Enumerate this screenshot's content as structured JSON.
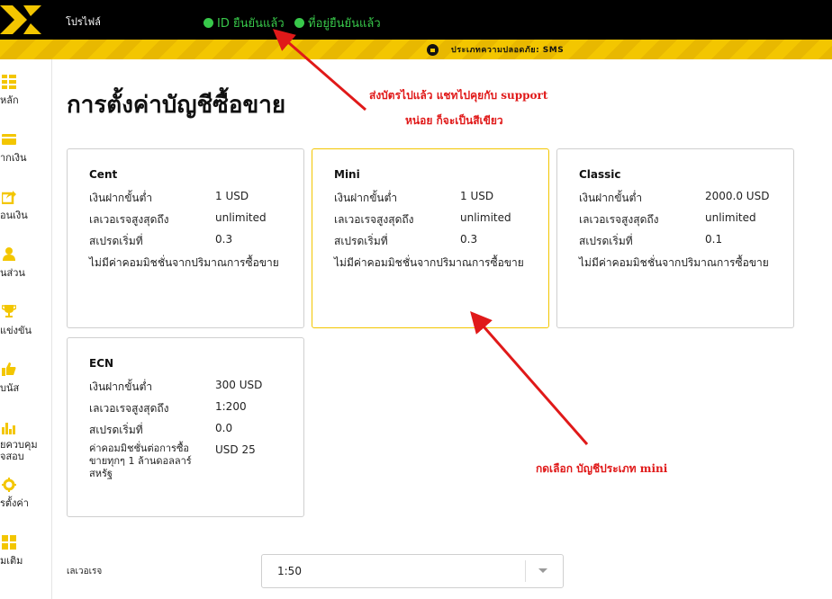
{
  "topbar": {
    "profile_label": "โปรไฟล์",
    "id_verified": "ID ยืนยันแล้ว",
    "address_verified": "ที่อยู่ยืนยันแล้ว",
    "security_type": "ประเภทความปลอดภัย: SMS"
  },
  "sidebar": {
    "items": [
      {
        "label": "หลัก",
        "icon": "dashboard-icon"
      },
      {
        "label": "ากเงิน",
        "icon": "card-icon"
      },
      {
        "label": "อนเงิน",
        "icon": "share-icon"
      },
      {
        "label": "นส่วน",
        "icon": "user-icon"
      },
      {
        "label": "แข่งขัน",
        "icon": "trophy-icon"
      },
      {
        "label": "บนัส",
        "icon": "thumbs-up-icon"
      },
      {
        "label": "ยควบคุม\nจสอบ",
        "icon": "bar-chart-icon"
      },
      {
        "label": "รตั้งค่า",
        "icon": "gear-icon"
      },
      {
        "label": "มเติม",
        "icon": "grid-icon"
      }
    ]
  },
  "page": {
    "title": "การตั้งค่าบัญชีซื้อขาย"
  },
  "accounts": [
    {
      "name": "Cent",
      "min_deposit_label": "เงินฝากขั้นต่ำ",
      "min_deposit": "1 USD",
      "max_leverage_label": "เลเวอเรจสูงสุดถึง",
      "max_leverage": "unlimited",
      "spread_label": "สเปรดเริ่มที่",
      "spread": "0.3",
      "commission_note": "ไม่มีค่าคอมมิชชั่นจากปริมาณการซื้อขาย"
    },
    {
      "name": "Mini",
      "min_deposit_label": "เงินฝากขั้นต่ำ",
      "min_deposit": "1 USD",
      "max_leverage_label": "เลเวอเรจสูงสุดถึง",
      "max_leverage": "unlimited",
      "spread_label": "สเปรดเริ่มที่",
      "spread": "0.3",
      "commission_note": "ไม่มีค่าคอมมิชชั่นจากปริมาณการซื้อขาย",
      "selected": true
    },
    {
      "name": "Classic",
      "min_deposit_label": "เงินฝากขั้นต่ำ",
      "min_deposit": "2000.0 USD",
      "max_leverage_label": "เลเวอเรจสูงสุดถึง",
      "max_leverage": "unlimited",
      "spread_label": "สเปรดเริ่มที่",
      "spread": "0.1",
      "commission_note": "ไม่มีค่าคอมมิชชั่นจากปริมาณการซื้อขาย"
    },
    {
      "name": "ECN",
      "min_deposit_label": "เงินฝากขั้นต่ำ",
      "min_deposit": "300 USD",
      "max_leverage_label": "เลเวอเรจสูงสุดถึง",
      "max_leverage": "1:200",
      "spread_label": "สเปรดเริ่มที่",
      "spread": "0.0",
      "commission_label": "ค่าคอมมิชชั่นต่อการซื้อขายทุกๆ 1 ล้านดอลลาร์สหรัฐ",
      "commission": "USD 25"
    }
  ],
  "leverage": {
    "label": "เลเวอเรจ",
    "value": "1:50"
  },
  "annotations": {
    "line1": "ส่งบัตรไปแล้ว แชทไปคุยกับ support",
    "line2": "หน่อย ก็จะเป็นสีเขียว",
    "select_mini": "กดเลือก บัญชีประเภท mini"
  },
  "colors": {
    "brand_yellow": "#f3c600",
    "verified_green": "#38c84a",
    "annotation_red": "#e01919"
  }
}
